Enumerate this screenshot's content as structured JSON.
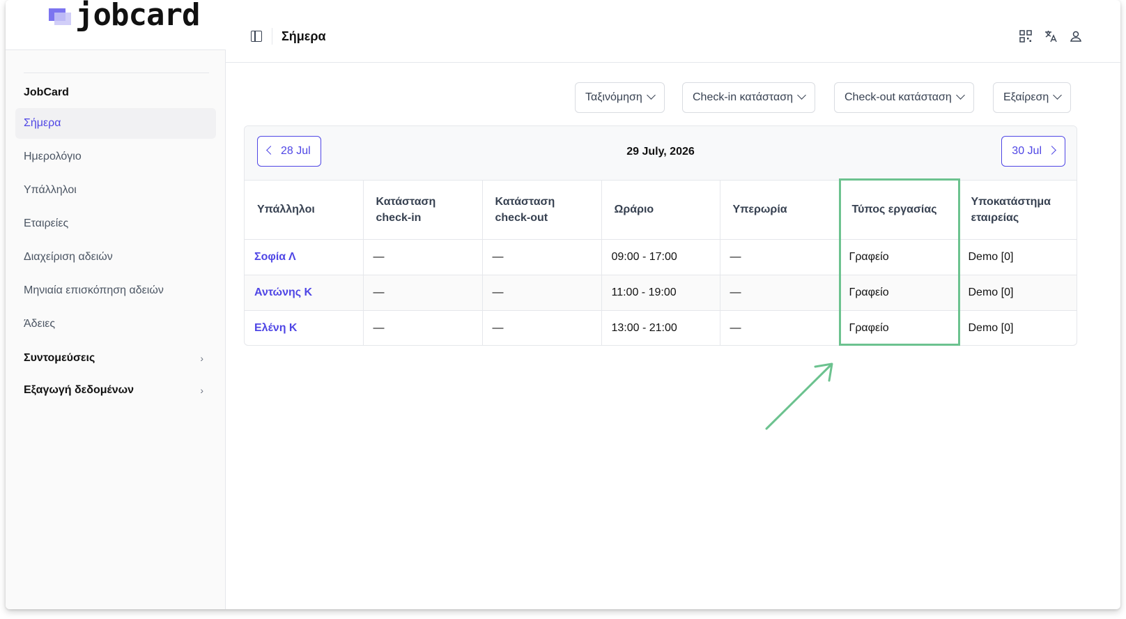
{
  "app": {
    "logo_text": "jobcard",
    "brand_color": "#4f46e5"
  },
  "sidebar": {
    "section_title": "JobCard",
    "items": [
      {
        "label": "Σήμερα",
        "active": true
      },
      {
        "label": "Ημερολόγιο"
      },
      {
        "label": "Υπάλληλοι"
      },
      {
        "label": "Εταιρείες"
      },
      {
        "label": "Διαχείριση αδειών"
      },
      {
        "label": "Μηνιαία επισκόπηση αδειών"
      },
      {
        "label": "Άδειες"
      }
    ],
    "groups": [
      {
        "label": "Συντομεύσεις",
        "icon": "chevron-right-icon"
      },
      {
        "label": "Εξαγωγή δεδομένων",
        "icon": "chevron-right-icon"
      }
    ]
  },
  "header": {
    "title": "Σήμερα",
    "icons": [
      "panel-toggle-icon",
      "qr-code-icon",
      "translate-icon",
      "user-icon"
    ]
  },
  "filters": [
    {
      "label": "Ταξινόμηση"
    },
    {
      "label": "Check-in κατάσταση"
    },
    {
      "label": "Check-out κατάσταση"
    },
    {
      "label": "Εξαίρεση"
    }
  ],
  "datebar": {
    "prev_label": "28 Jul",
    "current_label": "29 July, 2026",
    "next_label": "30 Jul"
  },
  "table": {
    "columns": [
      "Υπάλληλοι",
      "Κατάσταση check-in",
      "Κατάσταση check-out",
      "Ωράριο",
      "Υπερωρία",
      "Τύπος εργασίας",
      "Υποκατάστημα εταιρείας"
    ],
    "rows": [
      [
        "Σοφία Λ",
        "—",
        "—",
        "09:00 - 17:00",
        "—",
        "Γραφείο",
        "Demo [0]"
      ],
      [
        "Αντώνης Κ",
        "—",
        "—",
        "11:00 - 19:00",
        "—",
        "Γραφείο",
        "Demo [0]"
      ],
      [
        "Ελένη Κ",
        "—",
        "—",
        "13:00 - 21:00",
        "—",
        "Γραφείο",
        "Demo [0]"
      ]
    ]
  },
  "annotation": {
    "highlight_color": "#6cc28f"
  }
}
